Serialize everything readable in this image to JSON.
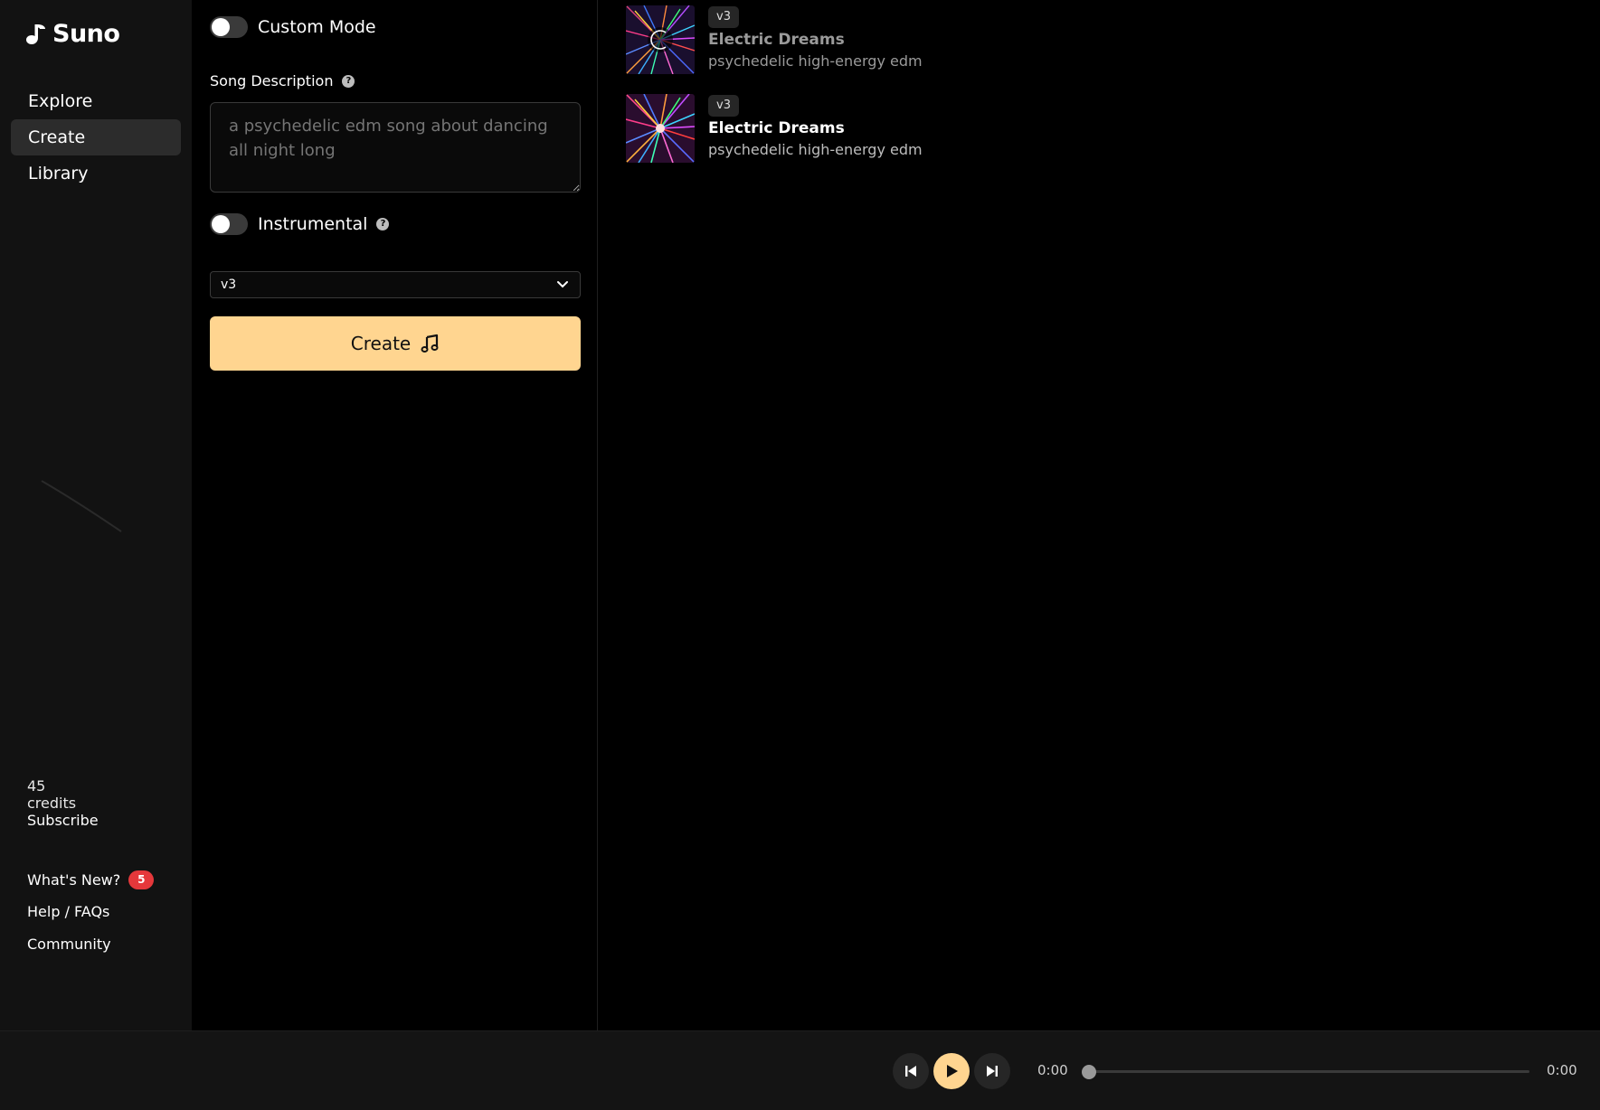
{
  "app": {
    "name": "Suno"
  },
  "sidebar": {
    "items": [
      {
        "label": "Explore",
        "active": false
      },
      {
        "label": "Create",
        "active": true
      },
      {
        "label": "Library",
        "active": false
      }
    ],
    "credits": "45 credits",
    "subscribe": "Subscribe",
    "whats_new": "What's New?",
    "whats_new_count": "5",
    "help": "Help / FAQs",
    "community": "Community"
  },
  "form": {
    "custom_mode_label": "Custom Mode",
    "custom_mode_on": false,
    "song_description_label": "Song Description",
    "song_description_placeholder": "a psychedelic edm song about dancing all night long",
    "instrumental_label": "Instrumental",
    "instrumental_on": false,
    "model_value": "v3",
    "create_label": "Create",
    "accent_color": "#ffd590"
  },
  "songs": [
    {
      "version": "v3",
      "title": "Electric Dreams",
      "tags": "psychedelic high-energy edm",
      "state": "generating"
    },
    {
      "version": "v3",
      "title": "Electric Dreams",
      "tags": "psychedelic high-energy edm",
      "state": "ready"
    }
  ],
  "player": {
    "current_time": "0:00",
    "duration": "0:00",
    "progress": 0
  }
}
